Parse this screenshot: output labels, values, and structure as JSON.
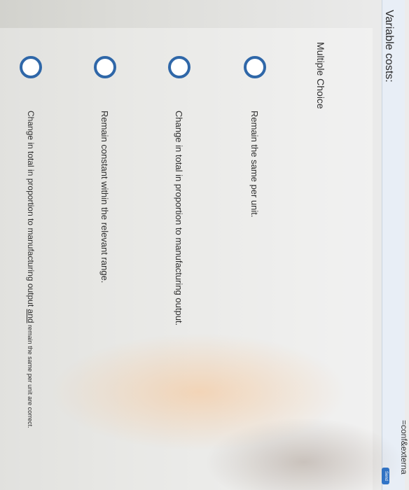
{
  "browser": {
    "url_fragment": "=conf&externa"
  },
  "question": {
    "title": "Variable costs:"
  },
  "toolbar": {
    "send_label": "Send"
  },
  "quiz": {
    "type_label": "Multiple Choice",
    "options": [
      {
        "label": "Remain the same per unit."
      },
      {
        "label": "Change in total in proportion to manufacturing output."
      },
      {
        "label": "Remain constant within the relevant range."
      },
      {
        "label_part1": "Change in total in proportion to manufacturing output ",
        "label_and": "and",
        "label_part2": " remain the same per unit are correct."
      }
    ]
  },
  "colors": {
    "radio": "#2f67a8",
    "send_button": "#2f74c9"
  }
}
